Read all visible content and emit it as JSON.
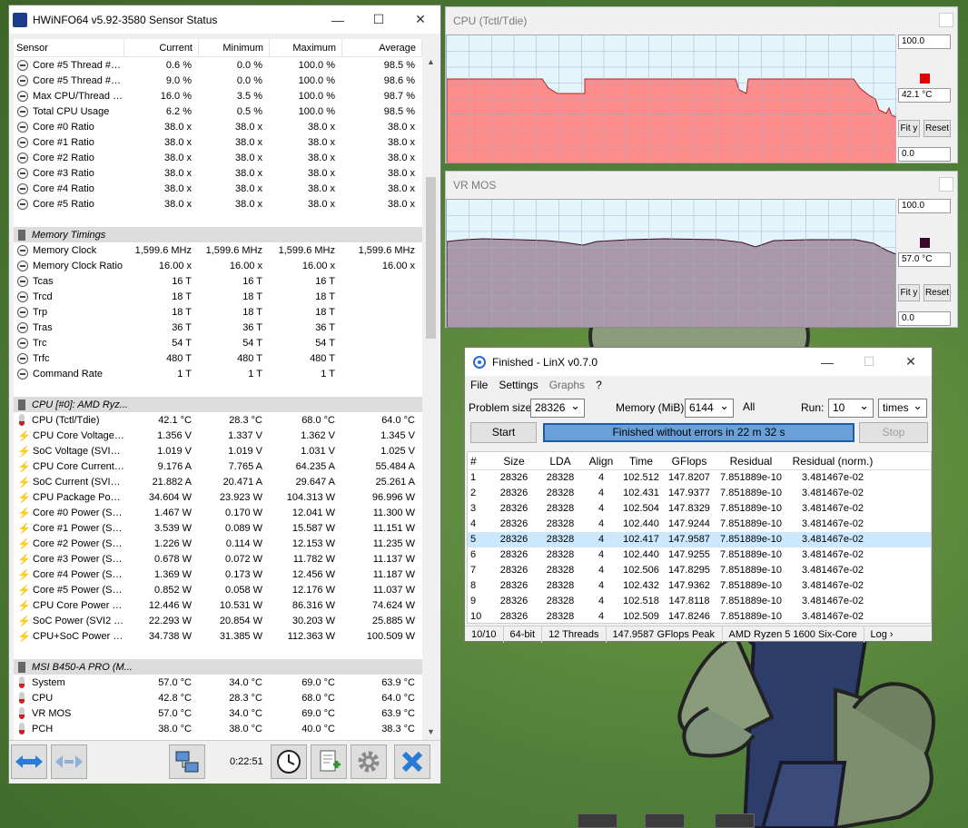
{
  "hwinfo": {
    "title": "HWiNFO64 v5.92-3580 Sensor Status",
    "columns": [
      "Sensor",
      "Current",
      "Minimum",
      "Maximum",
      "Average"
    ],
    "timer": "0:22:51",
    "sections": [
      {
        "group": null,
        "rows": [
          {
            "icon": "clock",
            "name": "Core #5 Thread #0...",
            "cur": "0.6 %",
            "min": "0.0 %",
            "max": "100.0 %",
            "avg": "98.5 %"
          },
          {
            "icon": "clock",
            "name": "Core #5 Thread #1...",
            "cur": "9.0 %",
            "min": "0.0 %",
            "max": "100.0 %",
            "avg": "98.6 %"
          },
          {
            "icon": "clock",
            "name": "Max CPU/Thread U...",
            "cur": "16.0 %",
            "min": "3.5 %",
            "max": "100.0 %",
            "avg": "98.7 %"
          },
          {
            "icon": "clock",
            "name": "Total CPU Usage",
            "cur": "6.2 %",
            "min": "0.5 %",
            "max": "100.0 %",
            "avg": "98.5 %"
          },
          {
            "icon": "clock",
            "name": "Core #0 Ratio",
            "cur": "38.0 x",
            "min": "38.0 x",
            "max": "38.0 x",
            "avg": "38.0 x"
          },
          {
            "icon": "clock",
            "name": "Core #1 Ratio",
            "cur": "38.0 x",
            "min": "38.0 x",
            "max": "38.0 x",
            "avg": "38.0 x"
          },
          {
            "icon": "clock",
            "name": "Core #2 Ratio",
            "cur": "38.0 x",
            "min": "38.0 x",
            "max": "38.0 x",
            "avg": "38.0 x"
          },
          {
            "icon": "clock",
            "name": "Core #3 Ratio",
            "cur": "38.0 x",
            "min": "38.0 x",
            "max": "38.0 x",
            "avg": "38.0 x"
          },
          {
            "icon": "clock",
            "name": "Core #4 Ratio",
            "cur": "38.0 x",
            "min": "38.0 x",
            "max": "38.0 x",
            "avg": "38.0 x"
          },
          {
            "icon": "clock",
            "name": "Core #5 Ratio",
            "cur": "38.0 x",
            "min": "38.0 x",
            "max": "38.0 x",
            "avg": "38.0 x"
          }
        ]
      },
      {
        "group": "Memory Timings",
        "rows": [
          {
            "icon": "clock",
            "name": "Memory Clock",
            "cur": "1,599.6 MHz",
            "min": "1,599.6 MHz",
            "max": "1,599.6 MHz",
            "avg": "1,599.6 MHz"
          },
          {
            "icon": "clock",
            "name": "Memory Clock Ratio",
            "cur": "16.00 x",
            "min": "16.00 x",
            "max": "16.00 x",
            "avg": "16.00 x"
          },
          {
            "icon": "clock",
            "name": "Tcas",
            "cur": "16 T",
            "min": "16 T",
            "max": "16 T",
            "avg": ""
          },
          {
            "icon": "clock",
            "name": "Trcd",
            "cur": "18 T",
            "min": "18 T",
            "max": "18 T",
            "avg": ""
          },
          {
            "icon": "clock",
            "name": "Trp",
            "cur": "18 T",
            "min": "18 T",
            "max": "18 T",
            "avg": ""
          },
          {
            "icon": "clock",
            "name": "Tras",
            "cur": "36 T",
            "min": "36 T",
            "max": "36 T",
            "avg": ""
          },
          {
            "icon": "clock",
            "name": "Trc",
            "cur": "54 T",
            "min": "54 T",
            "max": "54 T",
            "avg": ""
          },
          {
            "icon": "clock",
            "name": "Trfc",
            "cur": "480 T",
            "min": "480 T",
            "max": "480 T",
            "avg": ""
          },
          {
            "icon": "clock",
            "name": "Command Rate",
            "cur": "1 T",
            "min": "1 T",
            "max": "1 T",
            "avg": ""
          }
        ]
      },
      {
        "group": "CPU [#0]: AMD Ryz...",
        "rows": [
          {
            "icon": "therm",
            "name": "CPU (Tctl/Tdie)",
            "cur": "42.1 °C",
            "min": "28.3 °C",
            "max": "68.0 °C",
            "avg": "64.0 °C"
          },
          {
            "icon": "bolt",
            "name": "CPU Core Voltage (...",
            "cur": "1.356 V",
            "min": "1.337 V",
            "max": "1.362 V",
            "avg": "1.345 V"
          },
          {
            "icon": "bolt",
            "name": "SoC Voltage (SVI2 ...",
            "cur": "1.019 V",
            "min": "1.019 V",
            "max": "1.031 V",
            "avg": "1.025 V"
          },
          {
            "icon": "bolt",
            "name": "CPU Core Current (...",
            "cur": "9.176 A",
            "min": "7.765 A",
            "max": "64.235 A",
            "avg": "55.484 A"
          },
          {
            "icon": "bolt",
            "name": "SoC Current (SVI2 ...",
            "cur": "21.882 A",
            "min": "20.471 A",
            "max": "29.647 A",
            "avg": "25.261 A"
          },
          {
            "icon": "bolt",
            "name": "CPU Package Powe...",
            "cur": "34.604 W",
            "min": "23.923 W",
            "max": "104.313 W",
            "avg": "96.996 W"
          },
          {
            "icon": "bolt",
            "name": "Core #0 Power (SMU)",
            "cur": "1.467 W",
            "min": "0.170 W",
            "max": "12.041 W",
            "avg": "11.300 W"
          },
          {
            "icon": "bolt",
            "name": "Core #1 Power (SMU)",
            "cur": "3.539 W",
            "min": "0.089 W",
            "max": "15.587 W",
            "avg": "11.151 W"
          },
          {
            "icon": "bolt",
            "name": "Core #2 Power (SMU)",
            "cur": "1.226 W",
            "min": "0.114 W",
            "max": "12.153 W",
            "avg": "11.235 W"
          },
          {
            "icon": "bolt",
            "name": "Core #3 Power (SMU)",
            "cur": "0.678 W",
            "min": "0.072 W",
            "max": "11.782 W",
            "avg": "11.137 W"
          },
          {
            "icon": "bolt",
            "name": "Core #4 Power (SMU)",
            "cur": "1.369 W",
            "min": "0.173 W",
            "max": "12.456 W",
            "avg": "11.187 W"
          },
          {
            "icon": "bolt",
            "name": "Core #5 Power (SMU)",
            "cur": "0.852 W",
            "min": "0.058 W",
            "max": "12.176 W",
            "avg": "11.037 W"
          },
          {
            "icon": "bolt",
            "name": "CPU Core Power (S...",
            "cur": "12.446 W",
            "min": "10.531 W",
            "max": "86.316 W",
            "avg": "74.624 W"
          },
          {
            "icon": "bolt",
            "name": "SoC Power (SVI2 TFN)",
            "cur": "22.293 W",
            "min": "20.854 W",
            "max": "30.203 W",
            "avg": "25.885 W"
          },
          {
            "icon": "bolt",
            "name": "CPU+SoC Power (S...",
            "cur": "34.738 W",
            "min": "31.385 W",
            "max": "112.363 W",
            "avg": "100.509 W"
          }
        ]
      },
      {
        "group": "MSI B450-A PRO (M...",
        "rows": [
          {
            "icon": "therm",
            "name": "System",
            "cur": "57.0 °C",
            "min": "34.0 °C",
            "max": "69.0 °C",
            "avg": "63.9 °C"
          },
          {
            "icon": "therm",
            "name": "CPU",
            "cur": "42.8 °C",
            "min": "28.3 °C",
            "max": "68.0 °C",
            "avg": "64.0 °C"
          },
          {
            "icon": "therm",
            "name": "VR MOS",
            "cur": "57.0 °C",
            "min": "34.0 °C",
            "max": "69.0 °C",
            "avg": "63.9 °C"
          },
          {
            "icon": "therm",
            "name": "PCH",
            "cur": "38.0 °C",
            "min": "38.0 °C",
            "max": "40.0 °C",
            "avg": "38.3 °C"
          }
        ]
      }
    ]
  },
  "graph_cpu": {
    "title": "CPU (Tctl/Tdie)",
    "top": "100.0",
    "bottom": "0.0",
    "current": "42.1 °C",
    "fit": "Fit y",
    "reset": "Reset",
    "color": "#ff8c8c",
    "swatch": "#e00000"
  },
  "graph_vr": {
    "title": "VR MOS",
    "top": "100.0",
    "bottom": "0.0",
    "current": "57.0 °C",
    "fit": "Fit y",
    "reset": "Reset",
    "color": "#a898a8",
    "swatch": "#3a0a2a"
  },
  "linx": {
    "title": "Finished - LinX v0.7.0",
    "menu": [
      "File",
      "Settings",
      "Graphs",
      "?"
    ],
    "problem_label": "Problem size:",
    "problem_value": "28326",
    "memory_label": "Memory (MiB):",
    "memory_value": "6144",
    "all_label": "All",
    "run_label": "Run:",
    "run_value": "10",
    "run_unit": "times",
    "start": "Start",
    "stop": "Stop",
    "progress": "Finished without errors in 22 m 32 s",
    "columns": [
      "#",
      "Size",
      "LDA",
      "Align",
      "Time",
      "GFlops",
      "Residual",
      "Residual (norm.)"
    ],
    "rows": [
      [
        "1",
        "28326",
        "28328",
        "4",
        "102.512",
        "147.8207",
        "7.851889e-10",
        "3.481467e-02"
      ],
      [
        "2",
        "28326",
        "28328",
        "4",
        "102.431",
        "147.9377",
        "7.851889e-10",
        "3.481467e-02"
      ],
      [
        "3",
        "28326",
        "28328",
        "4",
        "102.504",
        "147.8329",
        "7.851889e-10",
        "3.481467e-02"
      ],
      [
        "4",
        "28326",
        "28328",
        "4",
        "102.440",
        "147.9244",
        "7.851889e-10",
        "3.481467e-02"
      ],
      [
        "5",
        "28326",
        "28328",
        "4",
        "102.417",
        "147.9587",
        "7.851889e-10",
        "3.481467e-02"
      ],
      [
        "6",
        "28326",
        "28328",
        "4",
        "102.440",
        "147.9255",
        "7.851889e-10",
        "3.481467e-02"
      ],
      [
        "7",
        "28326",
        "28328",
        "4",
        "102.506",
        "147.8295",
        "7.851889e-10",
        "3.481467e-02"
      ],
      [
        "8",
        "28326",
        "28328",
        "4",
        "102.432",
        "147.9362",
        "7.851889e-10",
        "3.481467e-02"
      ],
      [
        "9",
        "28326",
        "28328",
        "4",
        "102.518",
        "147.8118",
        "7.851889e-10",
        "3.481467e-02"
      ],
      [
        "10",
        "28326",
        "28328",
        "4",
        "102.509",
        "147.8246",
        "7.851889e-10",
        "3.481467e-02"
      ]
    ],
    "selected_row": 4,
    "status": [
      "10/10",
      "64-bit",
      "12 Threads",
      "147.9587 GFlops Peak",
      "AMD Ryzen 5 1600 Six-Core",
      "Log ›"
    ]
  }
}
